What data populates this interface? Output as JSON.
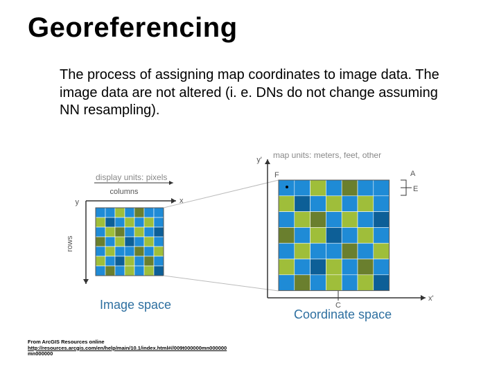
{
  "title": "Georeferencing",
  "body": "The process of assigning map coordinates to image data. The image data are not altered (i. e. DNs do not change assuming NN resampling).",
  "diagram": {
    "left": {
      "display_units": "display units: pixels",
      "columns_label": "columns",
      "rows_label": "rows",
      "x_axis": "x",
      "y_axis": "y",
      "caption": "Image space"
    },
    "right": {
      "map_units": "map units: meters, feet, other",
      "x_axis": "x'",
      "y_axis": "y'",
      "caption": "Coordinate space",
      "F": "F",
      "C": "C",
      "A": "A",
      "E": "E"
    },
    "grid_size": 7,
    "palette": {
      "blue": "#1f8bd6",
      "green": "#9fbe3a",
      "dark": "#0d5f97",
      "olive": "#6a7f2e",
      "gray": "#cfcfcf"
    }
  },
  "attribution": {
    "prefix": "From ArcGIS Resources online",
    "url": "http://resources.arcgis.com/en/help/main/10.1/index.html#//009t000000mn000000",
    "tail": "mn000000"
  }
}
